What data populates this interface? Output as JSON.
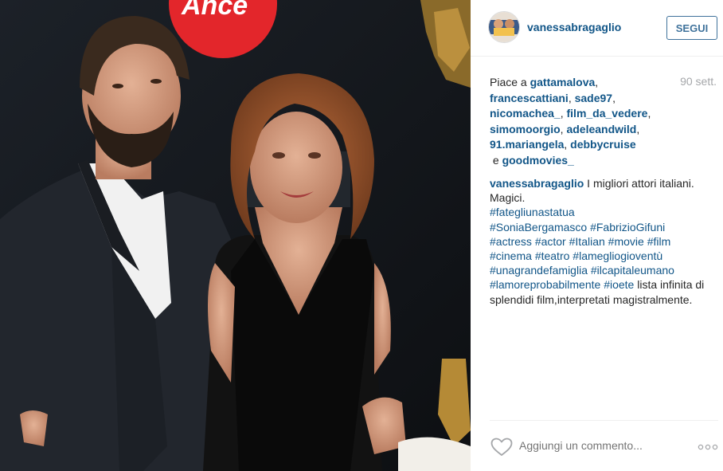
{
  "post": {
    "username": "vanessabragaglio",
    "follow_label": "SEGUI",
    "time": "90 sett.",
    "likes": {
      "prefix": "Piace a ",
      "users": [
        "gattamalova",
        "francescattiani",
        "sade97",
        "nicomachea_",
        "film_da_vedere",
        "simomoorgio",
        "adeleandwild",
        "91.mariangela",
        "debbycruise",
        "goodmovies_"
      ],
      "separator": ",",
      "conjunction": " e "
    },
    "caption": {
      "username": "vanessabragaglio",
      "text1": " I migliori attori italiani. Magici.",
      "hashtags": [
        "#fategliunastatua",
        "#SoniaBergamasco",
        "#FabrizioGifuni",
        "#actress",
        "#actor",
        "#Italian",
        "#movie",
        "#film",
        "#cinema",
        "#teatro",
        "#lamegliogioventù",
        "#unagrandefamiglia",
        "#ilcapitaleumano",
        "#lamoreprobabilmente",
        "#ioete"
      ],
      "text2": " lista infinita di splendidi film,interpretati magistralmente."
    },
    "comment_placeholder": "Aggiungi un commento...",
    "icons": {
      "like": "heart-icon",
      "more": "more-options-icon"
    },
    "colors": {
      "link": "#125688",
      "follow": "#3f729b",
      "text": "#262626",
      "muted": "#a5a7aa"
    }
  }
}
